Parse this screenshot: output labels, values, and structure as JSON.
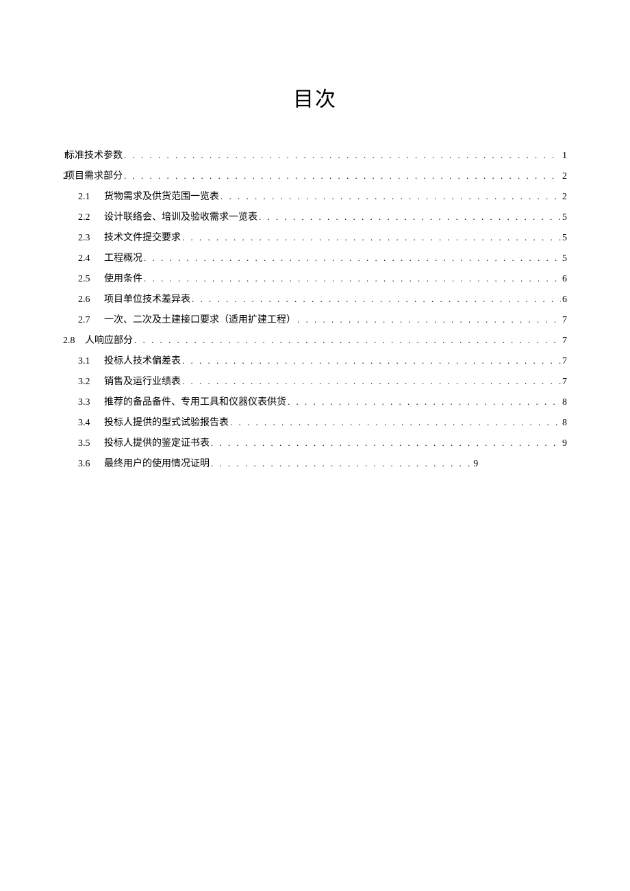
{
  "title": "目次",
  "entries": [
    {
      "type": "l1",
      "num": "1",
      "label": "标准技术参数",
      "page": "1"
    },
    {
      "type": "l1",
      "num": "2",
      "label": "项目需求部分",
      "page": "2"
    },
    {
      "type": "l2",
      "num": "2.1",
      "label": "货物需求及供货范围一览表",
      "page": "2"
    },
    {
      "type": "l2",
      "num": "2.2",
      "label": "设计联络会、培训及验收需求一览表",
      "page": "5"
    },
    {
      "type": "l2",
      "num": "2.3",
      "label": "技术文件提交要求",
      "page": "5"
    },
    {
      "type": "l2",
      "num": "2.4",
      "label": "工程概况",
      "page": "5"
    },
    {
      "type": "l2",
      "num": "2.5",
      "label": "使用条件",
      "page": "6"
    },
    {
      "type": "l2",
      "num": "2.6",
      "label": "项目单位技术差异表",
      "page": "6"
    },
    {
      "type": "l2",
      "num": "2.7",
      "label": "一次、二次及土建接口要求（适用扩建工程）",
      "page": "7"
    },
    {
      "type": "l28",
      "num": "2.8",
      "label": "人响应部分",
      "page": "7"
    },
    {
      "type": "l2",
      "num": "3.1",
      "label": "投标人技术偏差表",
      "page": "7"
    },
    {
      "type": "l2",
      "num": "3.2",
      "label": "销售及运行业绩表",
      "page": "7"
    },
    {
      "type": "l2",
      "num": "3.3",
      "label": "推荐的备品备件、专用工具和仪器仪表供货",
      "page": "8"
    },
    {
      "type": "l2",
      "num": "3.4",
      "label": "投标人提供的型式试验报告表",
      "page": "8"
    },
    {
      "type": "l2",
      "num": "3.5",
      "label": "投标人提供的鉴定证书表",
      "page": "9"
    },
    {
      "type": "l2short",
      "num": "3.6",
      "label": "最终用户的使用情况证明",
      "dots": ". . . . . . . . . . . . . . . . . . . . . . . . . . . . . . .",
      "page": "9"
    }
  ]
}
